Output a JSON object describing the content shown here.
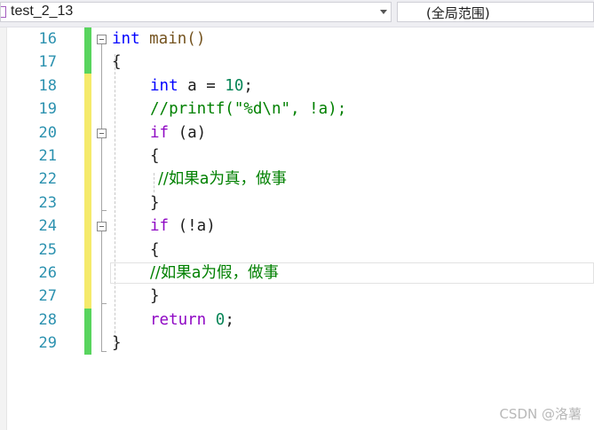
{
  "navbar": {
    "file_combo": "test_2_13",
    "scope_combo": "(全局范围)"
  },
  "editor": {
    "line_numbers": [
      "16",
      "17",
      "18",
      "19",
      "20",
      "21",
      "22",
      "23",
      "24",
      "25",
      "26",
      "27",
      "28",
      "29"
    ],
    "line_16": {
      "kw": "int",
      "rest": " main()"
    },
    "line_17": "{",
    "line_18": {
      "kw": "int",
      "rest": " a = ",
      "num": "10",
      "end": ";"
    },
    "line_19": "//printf(\"%d\\n\", !a);",
    "line_20": {
      "kw": "if",
      "rest": " (a)"
    },
    "line_21": "{",
    "line_22": "//如果a为真，做事",
    "line_23": "}",
    "line_24": {
      "kw": "if",
      "rest": " (!a)"
    },
    "line_25": "{",
    "line_26": "//如果a为假，做事",
    "line_27": "}",
    "line_28": {
      "kw": "return",
      "rest": " ",
      "num": "0",
      "end": ";"
    },
    "line_29": "}"
  },
  "watermark": "CSDN @洛薯",
  "colors": {
    "keyword_blue": "#0000ff",
    "control_keyword_purple": "#8f08c4",
    "comment_green": "#008000",
    "line_number_teal": "#2b91af",
    "saved_change": "#58d45e",
    "unsaved_change": "#f5ea6b"
  }
}
